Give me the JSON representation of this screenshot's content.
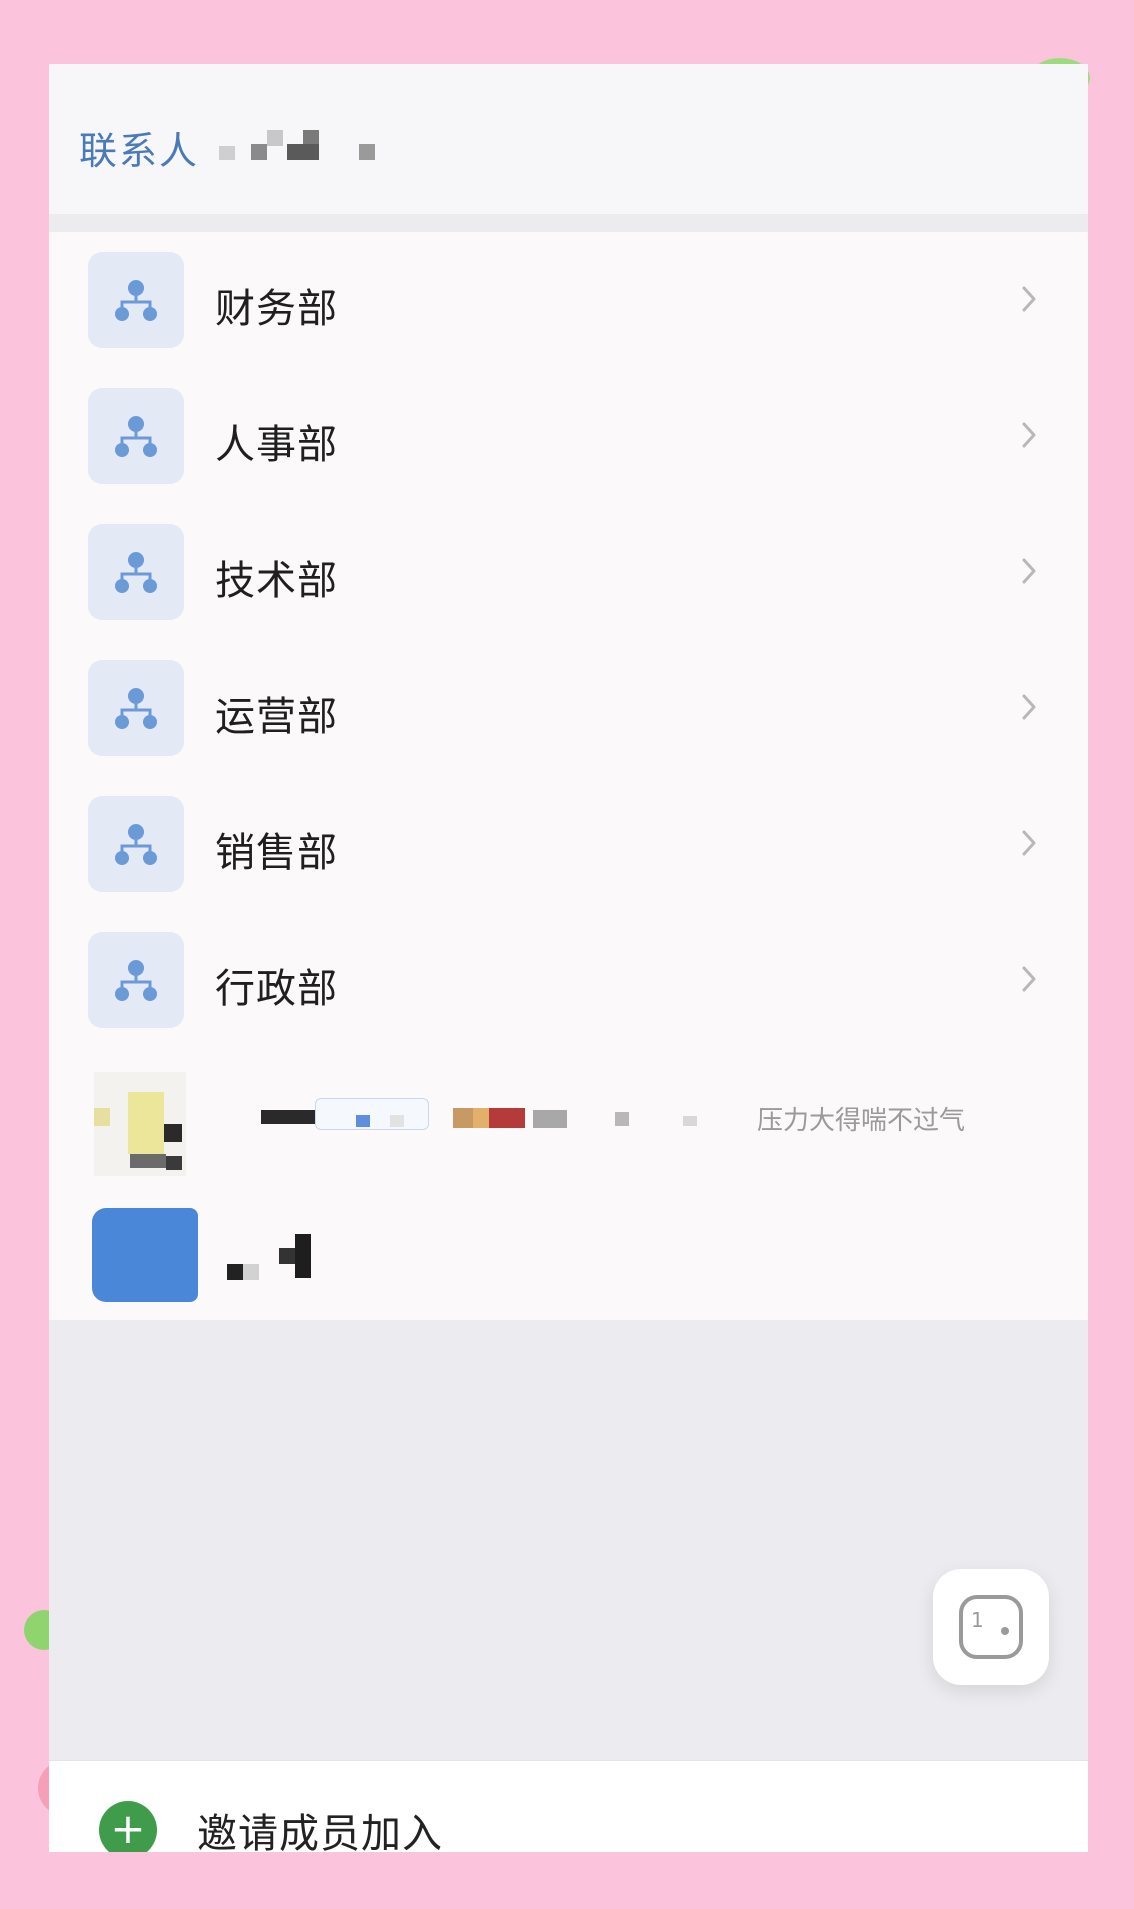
{
  "header": {
    "breadcrumb_root": "联系人"
  },
  "departments": [
    {
      "label": "财务部"
    },
    {
      "label": "人事部"
    },
    {
      "label": "技术部"
    },
    {
      "label": "运营部"
    },
    {
      "label": "销售部"
    },
    {
      "label": "行政部"
    }
  ],
  "member_row": {
    "status_text": "压力大得喘不过气"
  },
  "bottom_bar": {
    "invite_label": "邀请成员加入"
  },
  "icons": {
    "department": "org-chart-icon",
    "chevron": "chevron-right-icon",
    "invite": "plus-icon",
    "float": "chat-bubble-icon"
  },
  "colors": {
    "page_background": "#fcc4dc",
    "breadcrumb_accent": "#4a7bb7",
    "department_icon": "#6b9ad8",
    "invite_green": "#3f9c4a",
    "member_avatar_blue": "#4b87d9"
  }
}
